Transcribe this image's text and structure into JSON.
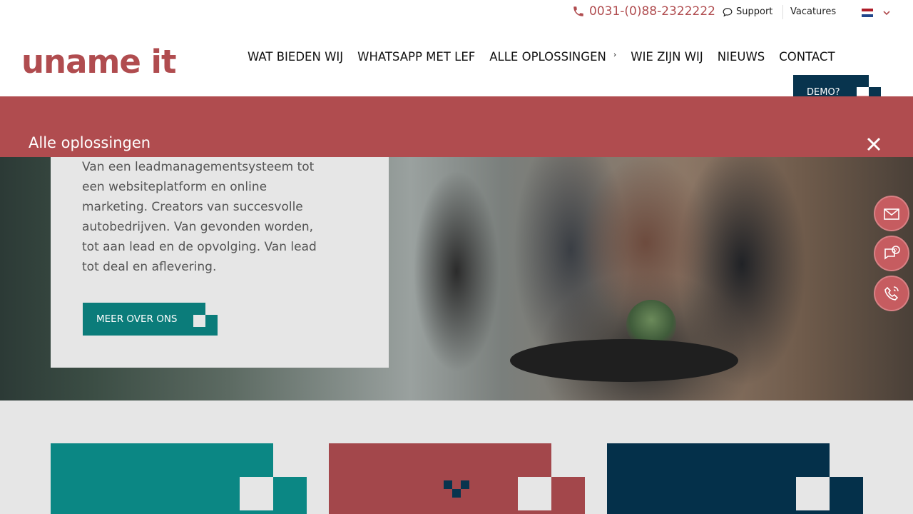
{
  "topbar": {
    "phone": "0031-(0)88-2322222",
    "support": "Support",
    "vacatures": "Vacatures",
    "language_flag": "nl-flag-icon"
  },
  "header": {
    "logo": "uname it",
    "nav": [
      {
        "label": "WAT BIEDEN WIJ"
      },
      {
        "label": "WHATSAPP MET LEF"
      },
      {
        "label": "ALLE OPLOSSINGEN"
      },
      {
        "label": "WIE ZIJN WIJ"
      },
      {
        "label": "NIEUWS"
      },
      {
        "label": "CONTACT"
      }
    ],
    "demo_button": "DEMO?"
  },
  "banner": {
    "title": "Alle oplossingen"
  },
  "hero": {
    "text": "Van een leadmanagementsysteem tot een websiteplatform en online marketing. Creators van succesvolle autobedrijven. Van gevonden worden, tot aan lead en de opvolging. Van lead tot deal en aflevering.",
    "button": "MEER OVER ONS"
  },
  "floating_actions": [
    {
      "icon": "mail-icon"
    },
    {
      "icon": "chat-question-icon"
    },
    {
      "icon": "phone-call-icon"
    }
  ],
  "colors": {
    "brand_red": "#b04c4f",
    "teal": "#0b7c7a",
    "navy": "#08344e",
    "background": "#e6e6e6"
  },
  "tiles": [
    {
      "color": "#0b8784"
    },
    {
      "color": "#a3474b"
    },
    {
      "color": "#04304a"
    }
  ]
}
